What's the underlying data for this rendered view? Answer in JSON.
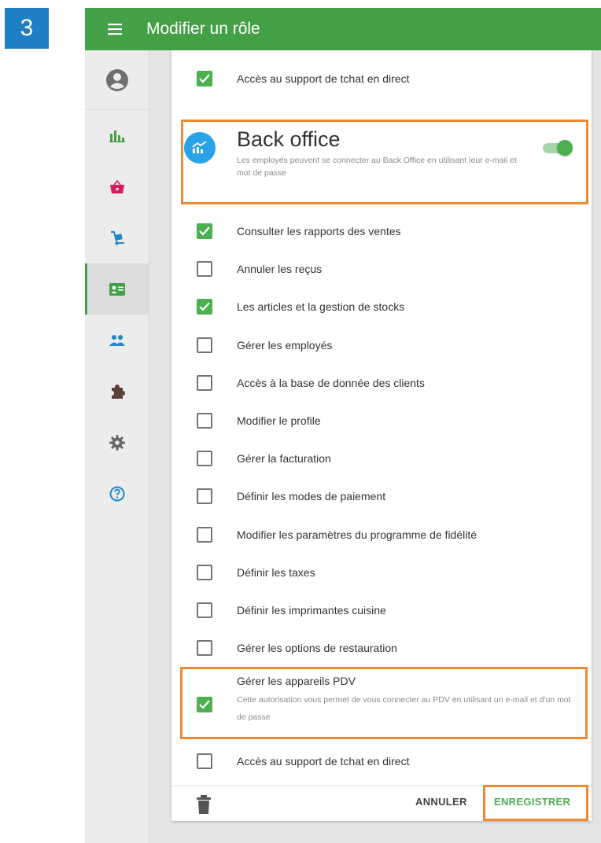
{
  "step_badge": "3",
  "appbar": {
    "title": "Modifier un rôle"
  },
  "colors": {
    "accent": "#43a047",
    "highlight": "#ee8a33",
    "step_badge": "#1f7fc4",
    "icon_blue": "#29a3e8",
    "basket": "#d81b60"
  },
  "sidebar": {
    "items": [
      {
        "icon": "bar-chart-icon"
      },
      {
        "icon": "basket-icon"
      },
      {
        "icon": "dolly-icon"
      },
      {
        "icon": "id-card-icon"
      },
      {
        "icon": "people-icon"
      },
      {
        "icon": "puzzle-icon"
      },
      {
        "icon": "gear-icon"
      },
      {
        "icon": "help-icon"
      }
    ]
  },
  "pos_top": {
    "label": "Accès au support de tchat en direct",
    "checked": true
  },
  "back_office": {
    "title": "Back office",
    "description": "Les employés peuvent se connecter au Back Office en utilisant leur e-mail et mot de passe",
    "enabled": true
  },
  "permissions": [
    {
      "label": "Consulter les rapports des ventes",
      "checked": true
    },
    {
      "label": "Annuler les reçus",
      "checked": false
    },
    {
      "label": "Les articles et la gestion de stocks",
      "checked": true
    },
    {
      "label": "Gérer les employés",
      "checked": false
    },
    {
      "label": "Accès à la base de donnée des clients",
      "checked": false
    },
    {
      "label": "Modifier le profile",
      "checked": false
    },
    {
      "label": "Gérer la facturation",
      "checked": false
    },
    {
      "label": "Définir les modes de paiement",
      "checked": false
    },
    {
      "label": "Modifier les paramètres du programme de fidélité",
      "checked": false
    },
    {
      "label": "Définir les taxes",
      "checked": false
    },
    {
      "label": "Définir les imprimantes cuisine",
      "checked": false
    },
    {
      "label": "Gérer les options de restauration",
      "checked": false
    }
  ],
  "pdv": {
    "label": "Gérer les appareils PDV",
    "description": "Cette autorisation vous permet de vous connecter au PDV en utilisant un e-mail et d'un mot de passe",
    "checked": true
  },
  "last_permission": {
    "label": "Accès au support de tchat en direct",
    "checked": false
  },
  "footer": {
    "cancel_label": "ANNULER",
    "save_label": "ENREGISTRER"
  }
}
